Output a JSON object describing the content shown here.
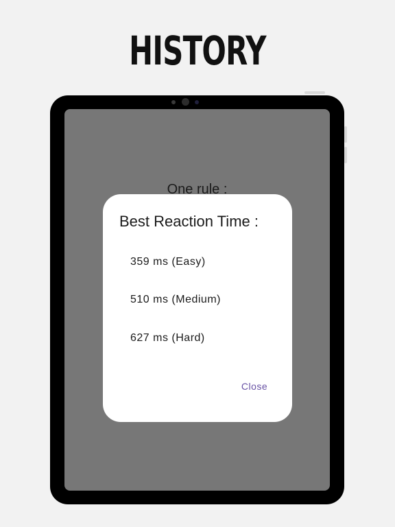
{
  "headline": "HISTORY",
  "background_screen": {
    "rule_text": "One rule :"
  },
  "dialog": {
    "title": "Best Reaction Time :",
    "scores": [
      "359 ms (Easy)",
      "510 ms (Medium)",
      "627 ms (Hard)"
    ],
    "close_label": "Close"
  },
  "colors": {
    "page_background": "#f2f2f2",
    "device_frame": "#000000",
    "screen_overlay": "#777777",
    "dialog_background": "#ffffff",
    "accent": "#6750a4"
  }
}
